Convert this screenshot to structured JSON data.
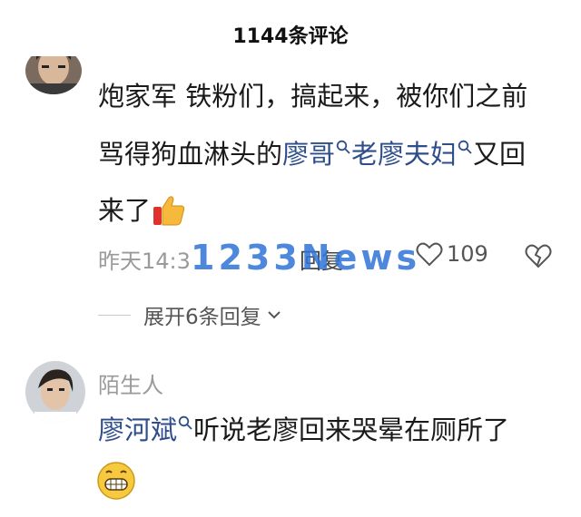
{
  "header": {
    "title": "1144条评论"
  },
  "comments": [
    {
      "line1": "炮家军  铁粉们，搞起来，被你们之前",
      "line2_pre": "骂得狗血淋头的",
      "link1": "廖哥",
      "link2": "老廖夫妇",
      "line2_post": "又回",
      "line3": "来了",
      "time": "昨天14:3",
      "reply": "回复",
      "likes": "109",
      "expand": "展开6条回复"
    },
    {
      "username": "陌生人",
      "link": "廖河斌",
      "text": "听说老廖回来哭晕在厕所了"
    }
  ],
  "watermark": "1233News",
  "colors": {
    "link": "#2d4e8b",
    "meta": "#9a9a9a",
    "watermark": "#2f74d8"
  }
}
